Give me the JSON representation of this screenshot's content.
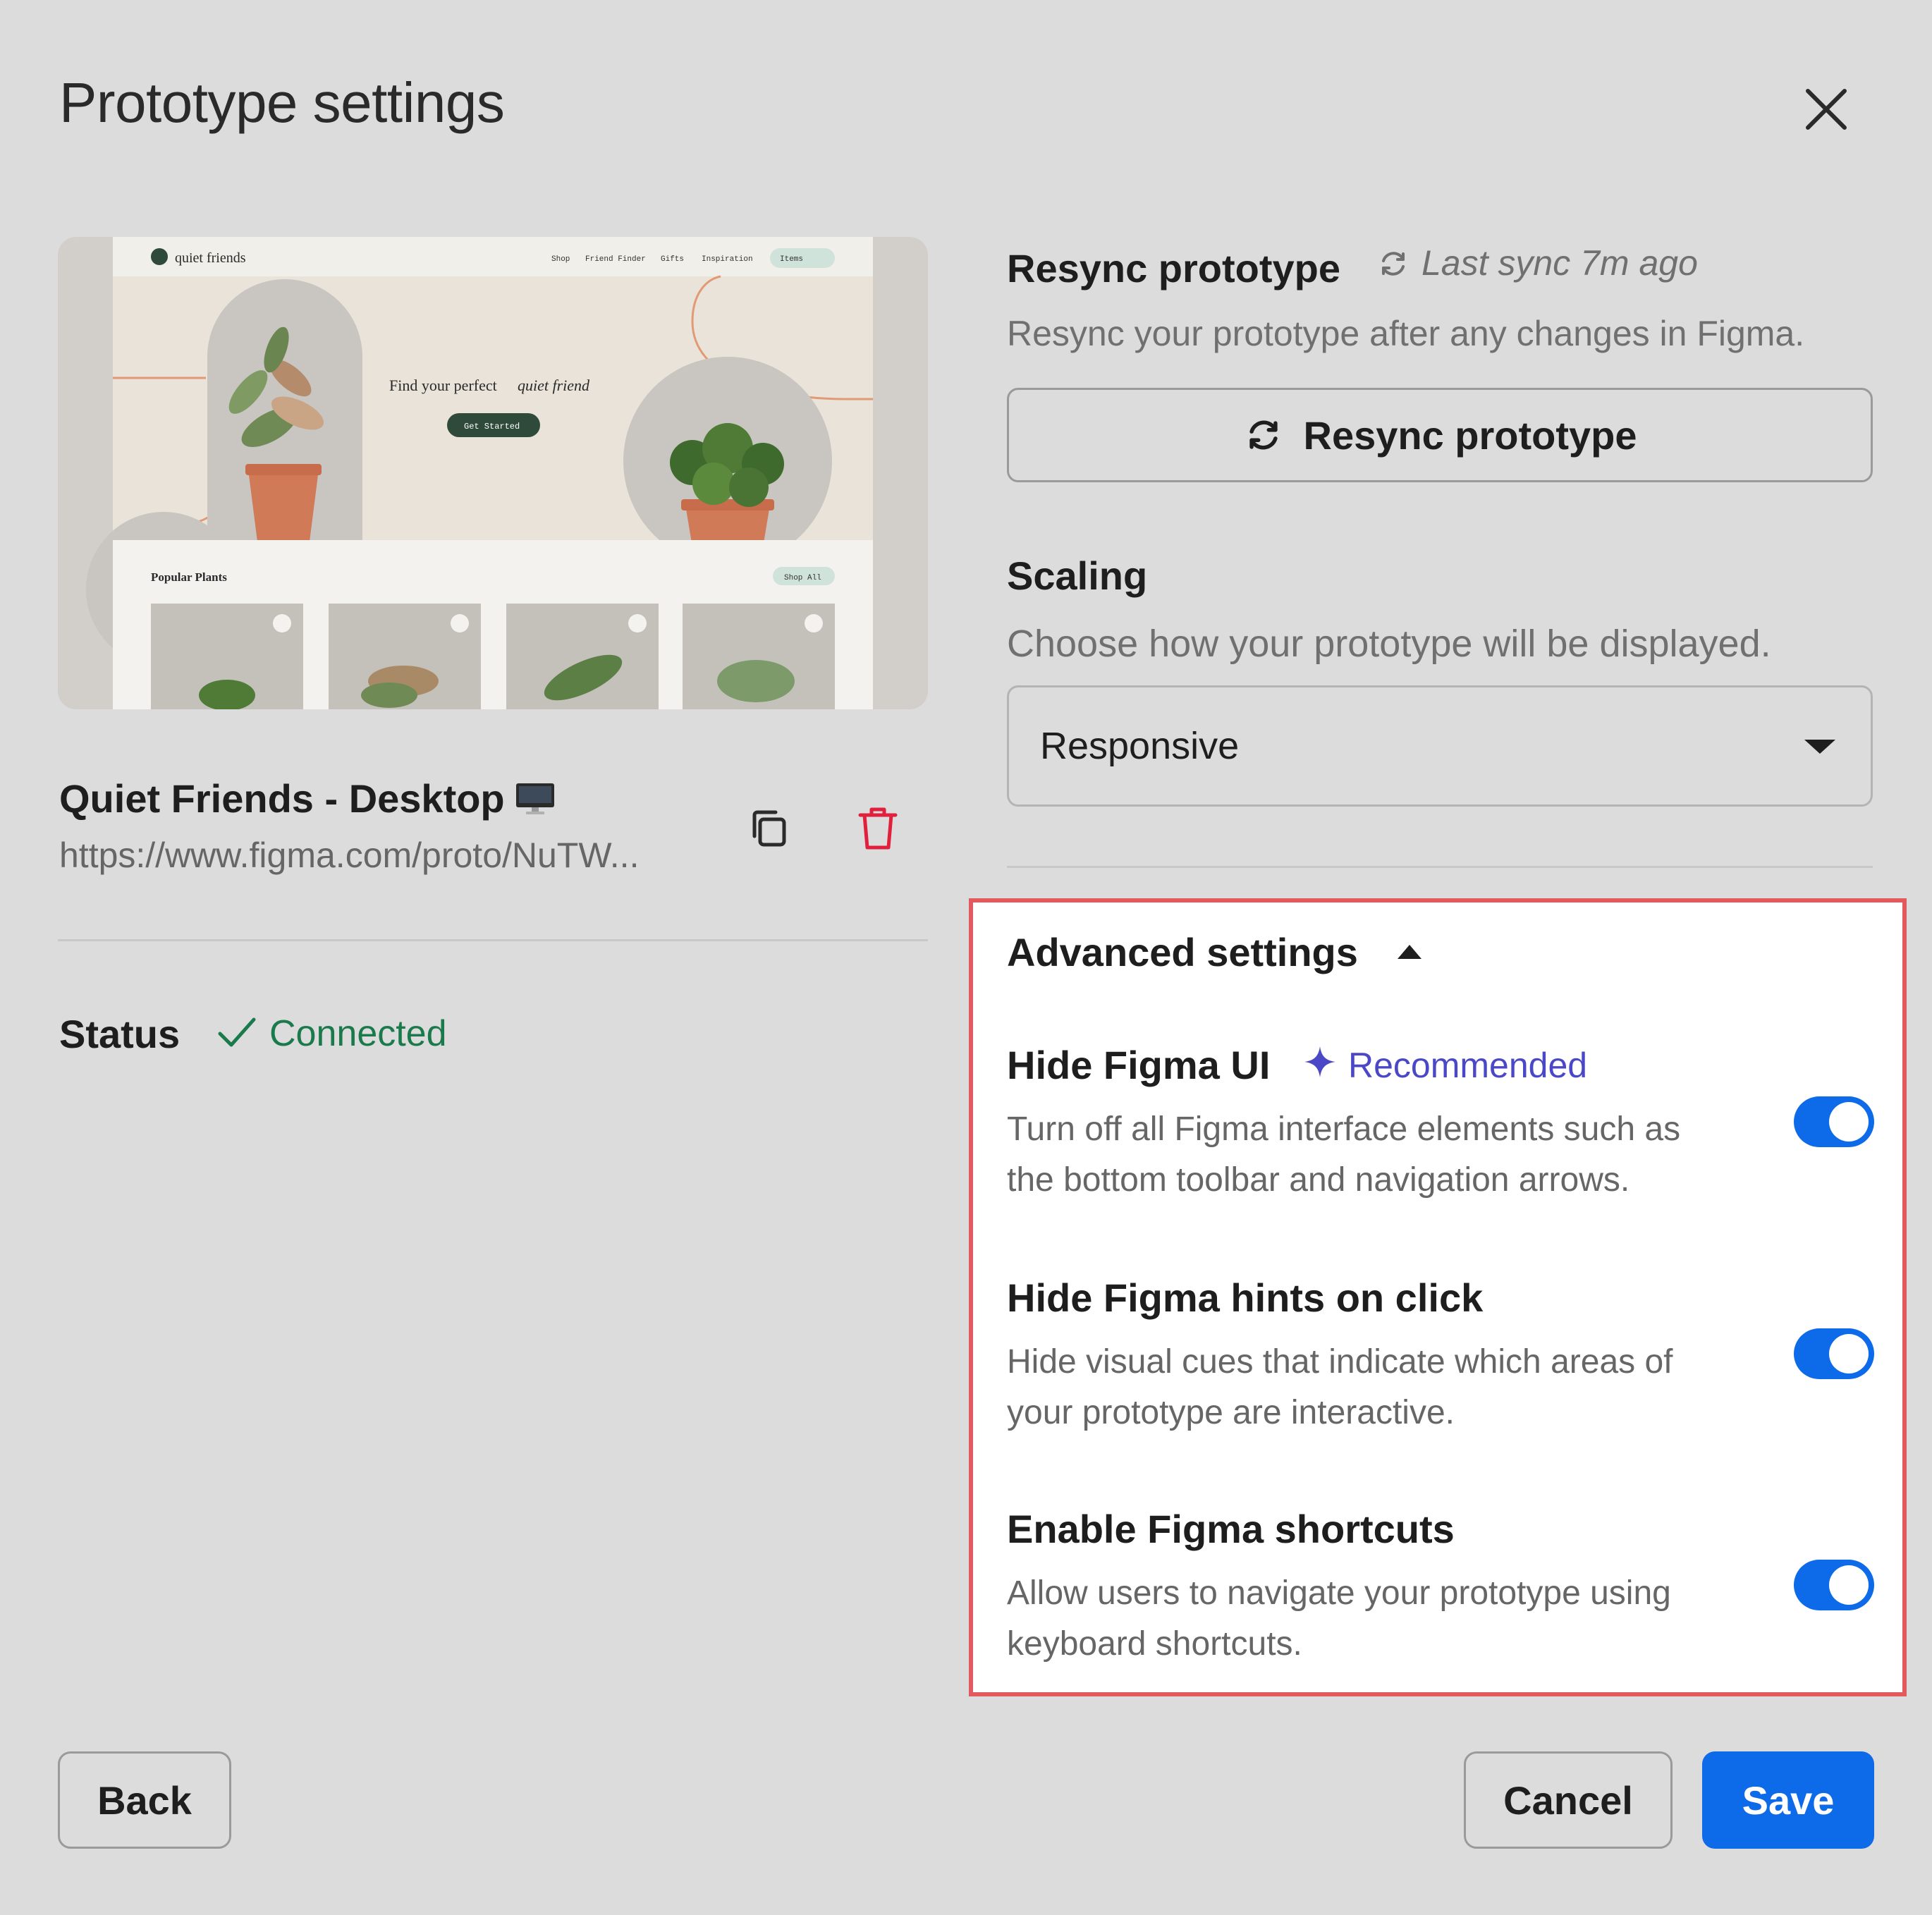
{
  "dialog": {
    "title": "Prototype settings",
    "close_icon": "close-icon"
  },
  "preview": {
    "site_logo": "quiet friends",
    "nav": [
      "Shop",
      "Friend Finder",
      "Gifts",
      "Inspiration",
      "Items"
    ],
    "hero_text": "Find your perfect",
    "hero_text_italic": "quiet friend",
    "cta": "Get Started",
    "section_title": "Popular Plants",
    "shop_all": "Shop All"
  },
  "prototype": {
    "name": "Quiet Friends - Desktop",
    "name_icon": "monitor-icon",
    "url": "https://www.figma.com/proto/NuTW...",
    "copy_icon": "copy-icon",
    "delete_icon": "trash-icon"
  },
  "status": {
    "label": "Status",
    "value": "Connected",
    "color": "#1a7a4c"
  },
  "resync": {
    "title": "Resync prototype",
    "last_sync": "Last sync 7m ago",
    "description": "Resync your prototype after any changes in Figma.",
    "button_label": "Resync prototype"
  },
  "scaling": {
    "title": "Scaling",
    "description": "Choose how your prototype will be displayed.",
    "selected": "Responsive"
  },
  "advanced": {
    "title": "Advanced settings",
    "expanded": true,
    "options": [
      {
        "title": "Hide Figma UI",
        "badge": "Recommended",
        "desc_line1": "Turn off all Figma interface elements such as",
        "desc_line2": "the bottom toolbar and navigation arrows.",
        "enabled": true
      },
      {
        "title": "Hide Figma hints on click",
        "desc_line1": "Hide visual cues that indicate which areas of",
        "desc_line2": "your prototype are interactive.",
        "enabled": true
      },
      {
        "title": "Enable Figma shortcuts",
        "desc_line1": "Allow users to navigate your prototype using",
        "desc_line2": "keyboard shortcuts.",
        "enabled": true
      }
    ]
  },
  "footer": {
    "back_label": "Back",
    "cancel_label": "Cancel",
    "save_label": "Save"
  },
  "colors": {
    "accent": "#0d6ae8",
    "highlight_border": "#e05a60",
    "recommended": "#4b48c8",
    "delete": "#e0203c"
  }
}
